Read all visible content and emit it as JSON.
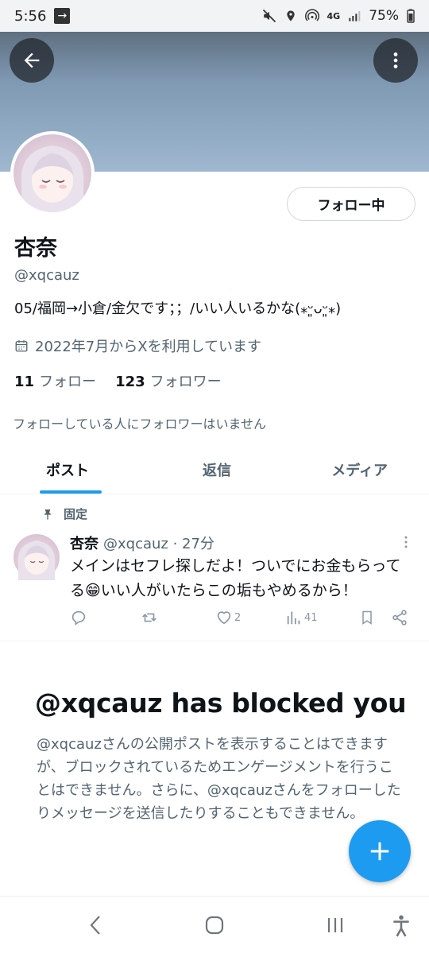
{
  "status_bar": {
    "time": "5:56",
    "network": "4G",
    "battery": "75%"
  },
  "profile": {
    "follow_button": "フォロー中",
    "display_name": "杏奈",
    "handle": "@xqcauz",
    "bio": "05/福岡→小倉/金欠です；；/いい人いるかな(⁎ᵕ͈ᴗᵕ͈⁎)",
    "joined": "2022年7月からXを利用しています",
    "following_count": "11",
    "following_label": "フォロー",
    "followers_count": "123",
    "followers_label": "フォロワー",
    "mutuals_text": "フォローしている人にフォロワーはいません"
  },
  "tabs": [
    "ポスト",
    "返信",
    "メディア"
  ],
  "pinned_tweet": {
    "pinned_label": "固定",
    "name": "杏奈",
    "meta": "@xqcauz · 27分",
    "text": "メインはセフレ探しだよ！ついでにお金もらってる😁いい人がいたらこの垢もやめるから！",
    "likes": "2",
    "views": "41"
  },
  "blocked": {
    "title": "@xqcauz has blocked you",
    "message": "@xqcauzさんの公開ポストを表示することはできますが、ブロックされているためエンゲージメントを行うことはできません。さらに、@xqcauzさんをフォローしたりメッセージを送信したりすることもできません。"
  },
  "colors": {
    "accent": "#1d9bf0",
    "secondary_text": "#536471"
  }
}
